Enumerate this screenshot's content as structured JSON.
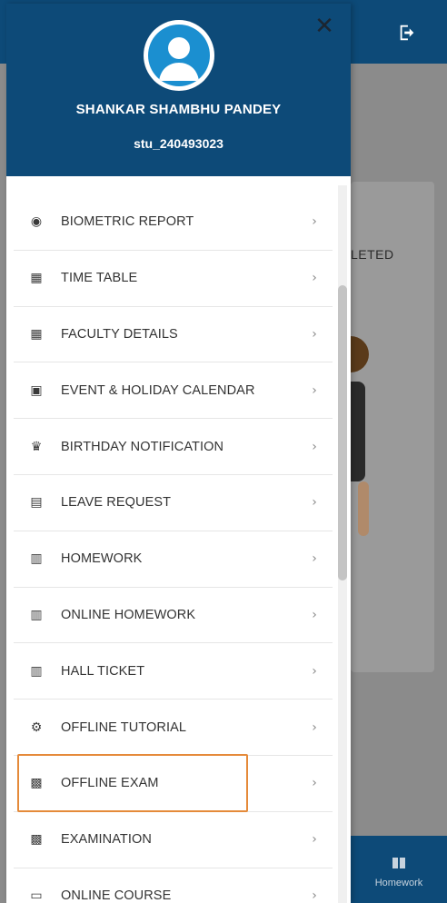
{
  "background": {
    "card_text": "LETED",
    "bottom_nav_label": "Homework"
  },
  "drawer": {
    "user_name": "SHANKAR SHAMBHU PANDEY",
    "user_id": "stu_240493023",
    "close_icon": "close-icon",
    "items": [
      {
        "label": "BIOMETRIC REPORT",
        "icon": "fingerprint-icon"
      },
      {
        "label": "TIME TABLE",
        "icon": "calendar-grid-icon"
      },
      {
        "label": "FACULTY DETAILS",
        "icon": "calendar-grid-icon"
      },
      {
        "label": "EVENT & HOLIDAY CALENDAR",
        "icon": "calendar-icon"
      },
      {
        "label": "BIRTHDAY NOTIFICATION",
        "icon": "cake-icon"
      },
      {
        "label": "LEAVE REQUEST",
        "icon": "calendar-x-icon"
      },
      {
        "label": "HOMEWORK",
        "icon": "book-open-icon"
      },
      {
        "label": "ONLINE HOMEWORK",
        "icon": "book-open-icon"
      },
      {
        "label": "HALL TICKET",
        "icon": "book-open-icon"
      },
      {
        "label": "OFFLINE TUTORIAL",
        "icon": "gear-icon"
      },
      {
        "label": "OFFLINE EXAM",
        "icon": "chalkboard-icon",
        "highlighted": true
      },
      {
        "label": "EXAMINATION",
        "icon": "chalkboard-icon"
      },
      {
        "label": "ONLINE COURSE",
        "icon": "laptop-icon"
      }
    ]
  },
  "colors": {
    "header": "#0d4a78",
    "highlight": "#e58a3a"
  }
}
